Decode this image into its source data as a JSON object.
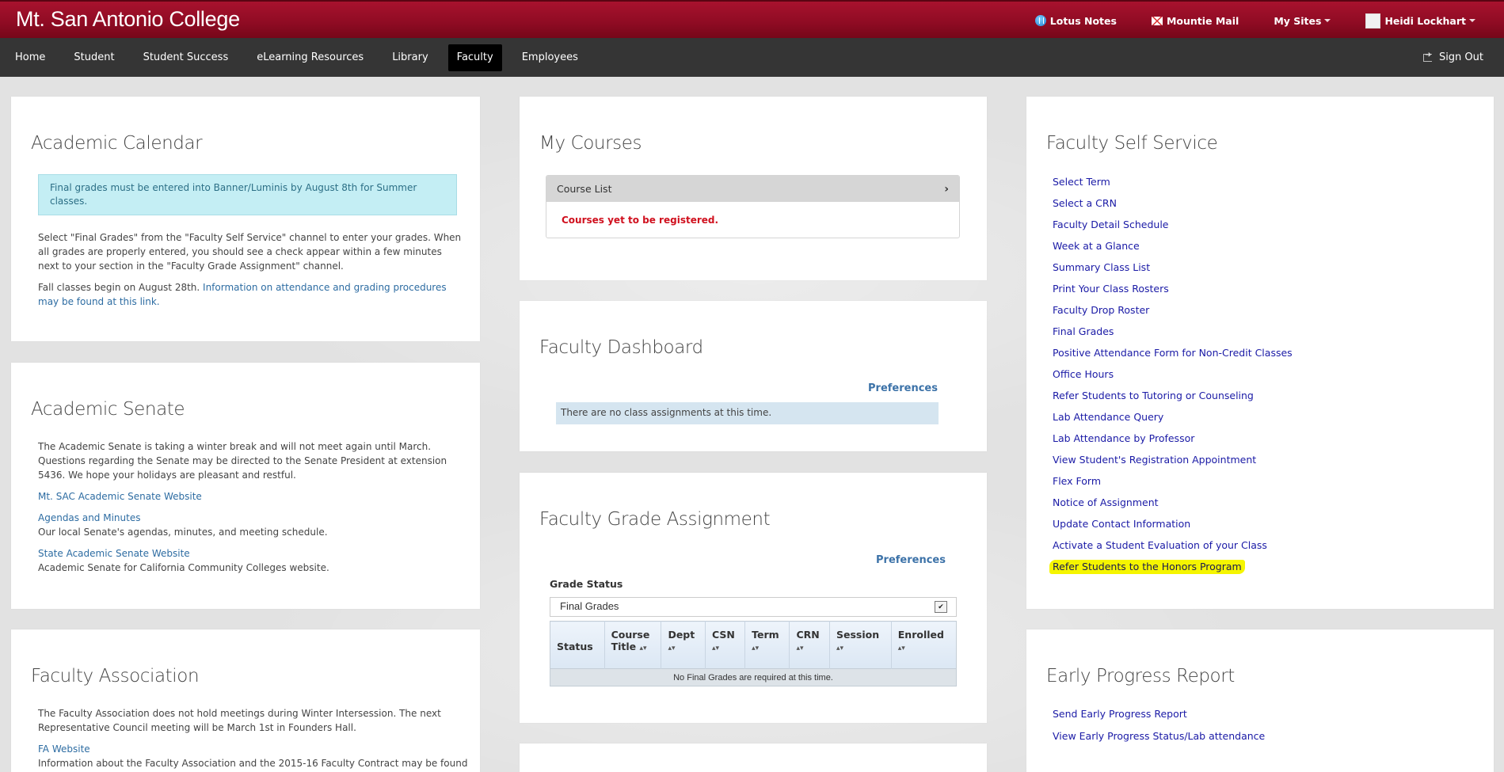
{
  "header": {
    "brand": "Mt. San Antonio College",
    "links": {
      "lotus": "Lotus Notes",
      "mail": "Mountie Mail",
      "sites": "My Sites",
      "user": "Heidi Lockhart"
    },
    "colors": {
      "brand_bar": "#9a0e27",
      "nav_bar": "#353535"
    }
  },
  "nav": {
    "items": [
      "Home",
      "Student",
      "Student Success",
      "eLearning Resources",
      "Library",
      "Faculty",
      "Employees"
    ],
    "active": "Faculty",
    "signout": "Sign Out"
  },
  "academic_calendar": {
    "title": "Academic Calendar",
    "alert": "Final grades must be entered into Banner/Luminis by August 8th for Summer classes.",
    "p1": "Select \"Final Grades\" from the \"Faculty Self Service\" channel to enter your grades.  When all grades are properly entered, you should see a check appear within a few minutes next to your section in the \"Faculty Grade Assignment\" channel.",
    "p2_text": "Fall classes begin on August 28th.  ",
    "p2_link": "Information on attendance and grading procedures may be found at this link."
  },
  "academic_senate": {
    "title": "Academic Senate",
    "p1": "The Academic Senate is taking a winter break and will not meet again until March.  Questions regarding the Senate may be directed to the Senate President at extension 5436.  We hope your holidays are pleasant and restful.",
    "link1": "Mt. SAC Academic Senate Website",
    "link2": "Agendas and Minutes",
    "desc2": "Our local Senate's agendas, minutes, and meeting schedule.",
    "link3": "State Academic Senate Website",
    "desc3": "Academic Senate for California Community Colleges website."
  },
  "faculty_association": {
    "title": "Faculty Association",
    "p1": "The Faculty Association does not hold meetings during Winter Intersession.  The next Representative Council meeting will be March 1st in Founders Hall.",
    "link1": "FA Website",
    "desc1": "Information about the Faculty Association and the 2015-16 Faculty Contract may be found"
  },
  "my_courses": {
    "title": "My Courses",
    "list_header": "Course List",
    "message": "Courses yet to be registered."
  },
  "faculty_dashboard": {
    "title": "Faculty Dashboard",
    "preferences": "Preferences",
    "message": "There are no class assignments at this time."
  },
  "grade_assignment": {
    "title": "Faculty Grade Assignment",
    "preferences": "Preferences",
    "status_label": "Grade Status",
    "status_value": "Final Grades",
    "columns": [
      {
        "line1": "Status",
        "line2": ""
      },
      {
        "line1": "Course",
        "line2": "Title"
      },
      {
        "line1": "Dept",
        "line2": ""
      },
      {
        "line1": "CSN",
        "line2": ""
      },
      {
        "line1": "Term",
        "line2": ""
      },
      {
        "line1": "CRN",
        "line2": ""
      },
      {
        "line1": "Session",
        "line2": ""
      },
      {
        "line1": "Enrolled",
        "line2": ""
      }
    ],
    "empty_message": "No Final Grades are required at this time."
  },
  "faculty_self_service": {
    "title": "Faculty Self Service",
    "links": [
      "Select Term",
      "Select a CRN",
      "Faculty Detail Schedule",
      "Week at a Glance",
      "Summary Class List",
      "Print Your Class Rosters",
      "Faculty Drop Roster",
      "Final Grades",
      "Positive Attendance Form for Non-Credit Classes",
      "Office Hours",
      "Refer Students to Tutoring or Counseling",
      "Lab Attendance Query",
      "Lab Attendance by Professor",
      "View Student's Registration Appointment",
      "Flex Form",
      "Notice of Assignment",
      "Update Contact Information",
      "Activate a Student Evaluation of your Class",
      "Refer Students to the Honors Program"
    ],
    "highlighted_index": 18
  },
  "early_progress": {
    "title": "Early Progress Report",
    "link1": "Send Early Progress Report",
    "link2": "View Early Progress Status/Lab attendance"
  }
}
